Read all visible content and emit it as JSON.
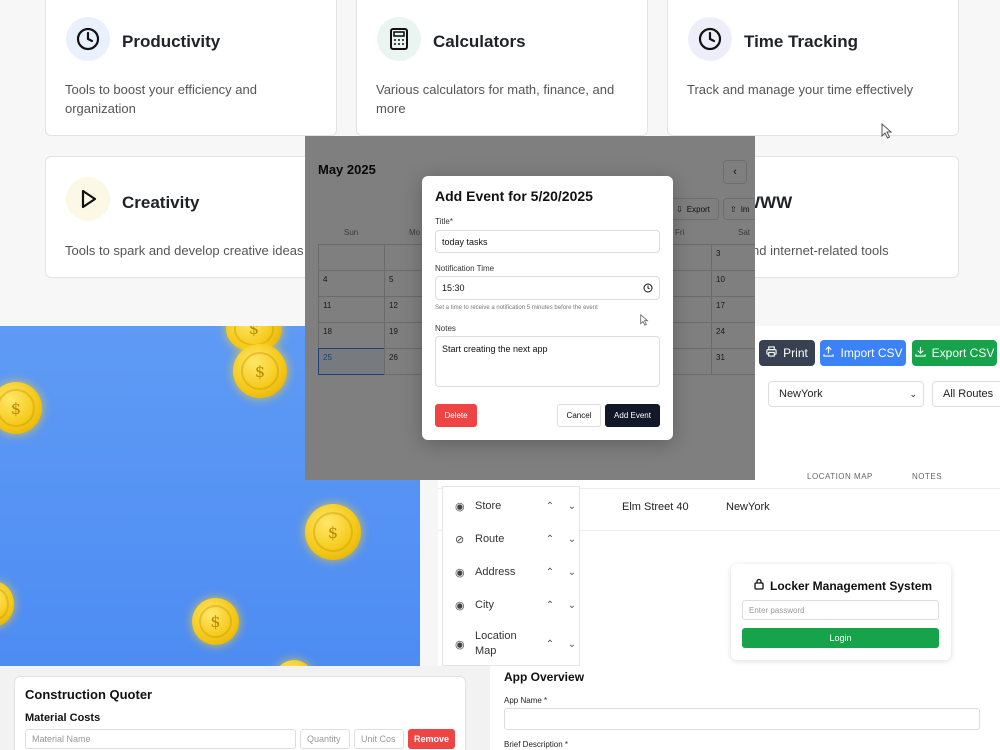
{
  "categories": [
    {
      "title": "Productivity",
      "desc": "Tools to boost your efficiency and organization",
      "icon": "clock-icon"
    },
    {
      "title": "Calculators",
      "desc": "Various calculators for math, finance, and more",
      "icon": "calculator-icon"
    },
    {
      "title": "Time Tracking",
      "desc": "Track and manage your time effectively",
      "icon": "clock-icon"
    },
    {
      "title": "Creativity",
      "desc": "Tools to spark and develop creative ideas",
      "icon": "play-icon"
    },
    {
      "title": "WWW",
      "desc": "...opment and internet-related tools",
      "icon": "globe-icon"
    }
  ],
  "calendar": {
    "month": "May 2025",
    "prev_label": "‹",
    "export_label": "Export",
    "import_label": "Im",
    "weekdays": [
      "Sun",
      "Mo",
      "Fri",
      "Sat"
    ],
    "days": [
      "3",
      "4",
      "5",
      "10",
      "11",
      "12",
      "17",
      "18",
      "19",
      "24",
      "25",
      "26",
      "31"
    ]
  },
  "modal": {
    "title": "Add Event for 5/20/2025",
    "title_label": "Title*",
    "title_value": "today tasks",
    "time_label": "Notification Time",
    "time_value": "15:30",
    "time_hint": "Set a time to receive a notification 5 minutes before the event",
    "notes_label": "Notes",
    "notes_value": "Start creating the next app",
    "delete_label": "Delete",
    "cancel_label": "Cancel",
    "add_label": "Add Event"
  },
  "admin": {
    "print_label": "Print",
    "import_label": "Import CSV",
    "export_label": "Export CSV",
    "city_select": "NewYork",
    "route_select": "All Routes",
    "col_location_map": "LOCATION MAP",
    "col_notes": "NOTES",
    "row": {
      "address": "Elm Street 40",
      "city": "NewYork"
    },
    "fields": [
      "Store",
      "Route",
      "Address",
      "City",
      "Location Map"
    ],
    "locker": {
      "title": "Locker Management System",
      "password_placeholder": "Enter password",
      "login_label": "Login"
    }
  },
  "quoter": {
    "title": "Construction Quoter",
    "section": "Material Costs",
    "material_placeholder": "Material Name",
    "quantity_placeholder": "Quantity",
    "unit_cost_placeholder": "Unit Cos",
    "remove_label": "Remove"
  },
  "app_overview": {
    "title": "App Overview",
    "app_name_label": "App Name *",
    "brief_label": "Brief Description *"
  },
  "colors": {
    "blue_button": "#3b82f6",
    "green_button": "#16a34a",
    "dark_button": "#374151",
    "danger": "#ef4444",
    "coin_bg": "#5f9bf5"
  }
}
